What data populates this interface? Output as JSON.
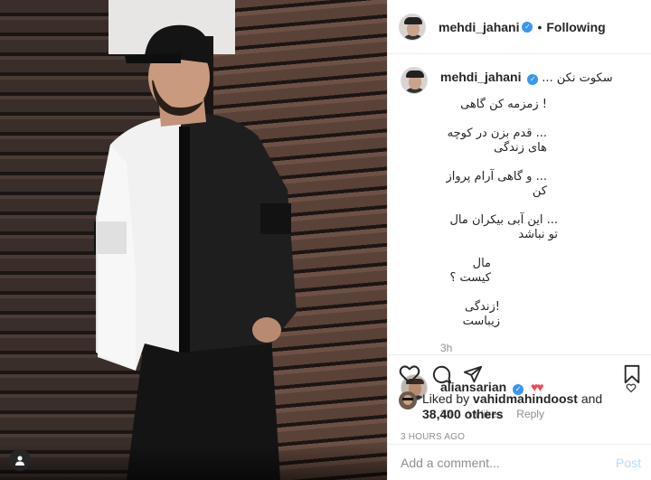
{
  "post": {
    "author": "mehdi_jahani",
    "separator": "•",
    "following_label": "Following"
  },
  "caption": {
    "username": "mehdi_jahani",
    "lines": [
      "... سکوت نکن",
      "! زمزمه کن گاهی",
      "... قدم بزن در کوچه های زندگی",
      "... و گاهی آرام پرواز کن",
      "... این آبی بیکران مال تو نباشد",
      "مال کیست ؟",
      "!زندگی زیباست"
    ],
    "time": "3h"
  },
  "reply": {
    "username": "aliansarian",
    "text": "♥♥",
    "time": "3h",
    "likes": "۱۹ likes",
    "reply_label": "Reply"
  },
  "likes": {
    "prefix": "Liked by",
    "user": "vahidmahindoost",
    "and": "and",
    "others": "38,400 others"
  },
  "posted_ago": "3 HOURS AGO",
  "comment_box": {
    "placeholder": "Add a comment...",
    "post_label": "Post"
  },
  "colors": {
    "verified": "#3897f0",
    "heart": "#ed4956",
    "post_disabled": "#b3dbff",
    "muted": "#8e8e8e"
  },
  "icons": [
    "heart-icon",
    "comment-icon",
    "share-icon",
    "bookmark-icon",
    "verified-icon",
    "user-tag-icon"
  ]
}
